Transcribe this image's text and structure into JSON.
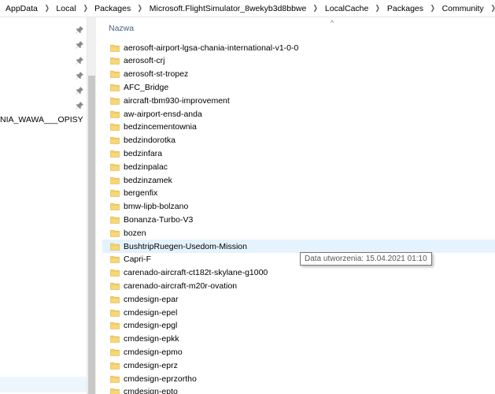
{
  "breadcrumb": [
    "AppData",
    "Local",
    "Packages",
    "Microsoft.FlightSimulator_8wekyb3d8bbwe",
    "LocalCache",
    "Packages",
    "Community"
  ],
  "nav": {
    "partial_label": "NIA_WAWA___OPISY",
    "pin_count": 6
  },
  "list": {
    "column_header": "Nazwa",
    "sort_glyph": "^",
    "items": [
      "aerosoft-airport-lgsa-chania-international-v1-0-0",
      "aerosoft-crj",
      "aerosoft-st-tropez",
      "AFC_Bridge",
      "aircraft-tbm930-improvement",
      "aw-airport-ensd-anda",
      "bedzincementownia",
      "bedzindorotka",
      "bedzinfara",
      "bedzinpalac",
      "bedzinzamek",
      "bergenfix",
      "bmw-lipb-bolzano",
      "Bonanza-Turbo-V3",
      "bozen",
      "BushtripRuegen-Usedom-Mission",
      "Capri-F",
      "carenado-aircraft-ct182t-skylane-g1000",
      "carenado-aircraft-m20r-ovation",
      "cmdesign-epar",
      "cmdesign-epel",
      "cmdesign-epgl",
      "cmdesign-epkk",
      "cmdesign-epmo",
      "cmdesign-eprz",
      "cmdesign-eprzortho",
      "cmdesign-epto"
    ],
    "hovered_index": 15
  },
  "tooltip": {
    "text": "Data utworzenia: 15.04.2021 01:10"
  },
  "colors": {
    "folder_yellow": "#f8d775",
    "hover_row": "#e5f3ff",
    "header_text": "#4d6182"
  }
}
